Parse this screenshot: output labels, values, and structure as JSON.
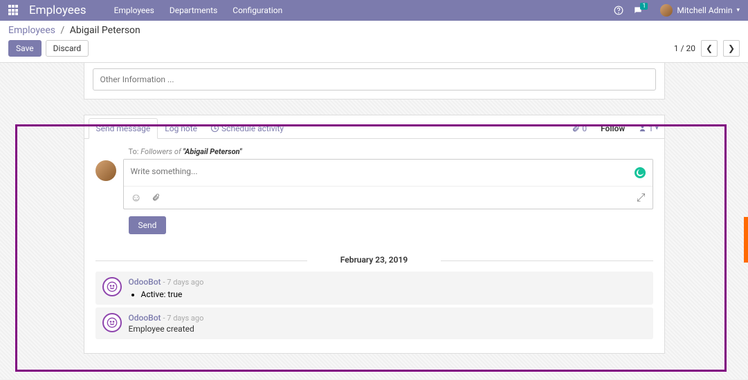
{
  "nav": {
    "app_title": "Employees",
    "links": [
      "Employees",
      "Departments",
      "Configuration"
    ],
    "msg_badge": "1",
    "user_name": "Mitchell Admin"
  },
  "breadcrumb": {
    "root": "Employees",
    "current": "Abigail Peterson"
  },
  "actions": {
    "save": "Save",
    "discard": "Discard"
  },
  "pager": {
    "text": "1 / 20"
  },
  "other_info_placeholder": "Other Information ...",
  "chatter": {
    "tabs": {
      "send": "Send message",
      "log": "Log note",
      "schedule": "Schedule activity"
    },
    "attach_count": "0",
    "follow": "Follow",
    "follower_count": "1",
    "to_prefix": "To:",
    "to_followers": "Followers of",
    "to_record": "\"Abigail Peterson\"",
    "placeholder": "Write something...",
    "send_label": "Send",
    "date_separator": "February 23, 2019",
    "messages": [
      {
        "author": "OdooBot",
        "time": "- 7 days ago",
        "bullet": "Active: true"
      },
      {
        "author": "OdooBot",
        "time": "- 7 days ago",
        "plain": "Employee created"
      }
    ]
  }
}
